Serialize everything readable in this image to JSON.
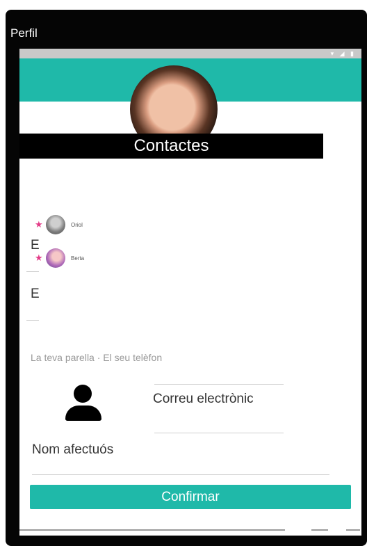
{
  "app_bar": {
    "title": "Perfil"
  },
  "status_bar": {
    "icons": "▾ ◢ ▮"
  },
  "contacts": {
    "title": "Contactes",
    "items": [
      {
        "name": "Oriol",
        "favorite": true,
        "avatar_icon": "contact-photo"
      },
      {
        "name": "Berta",
        "favorite": true,
        "avatar_icon": "contact-photo"
      }
    ]
  },
  "partial_fields": {
    "first_initial": "E",
    "second_initial": "E"
  },
  "section": {
    "hidden_label": "La teva parella · El seu telèfon"
  },
  "form": {
    "email_placeholder": "Correu electrònic",
    "nickname_placeholder": "Nom afectuós",
    "confirm_label": "Confirmar"
  },
  "colors": {
    "accent": "#1fb9a9",
    "star": "#e33b87",
    "header_bg": "#000000"
  }
}
